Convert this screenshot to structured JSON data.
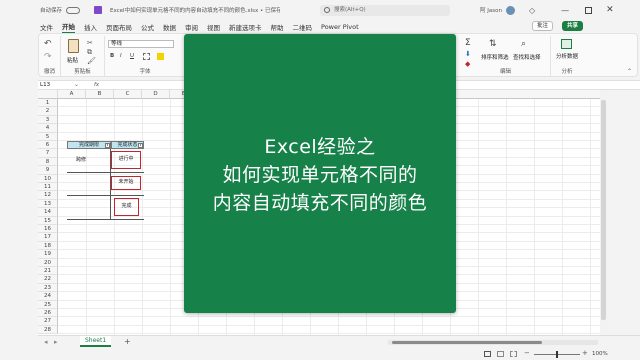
{
  "titlebar": {
    "autosave": "自动保存",
    "title": "Excel中如何实现单元格不同的内容自动填充不同的颜色.xlsx • 已保存",
    "search": "搜索(Alt+Q)",
    "user": "阿 Jason"
  },
  "tabs": [
    "文件",
    "开始",
    "插入",
    "页面布局",
    "公式",
    "数据",
    "审阅",
    "视图",
    "新建选项卡",
    "帮助",
    "二维码",
    "Power Pivot"
  ],
  "ribbon": {
    "comment_btn": "批注",
    "share_btn": "共享",
    "undo_label": "撤消",
    "clipboard_label": "剪贴板",
    "paste_label": "粘贴",
    "font_label": "字体",
    "font_name": "等线",
    "bold": "B",
    "italic": "I",
    "underline": "U",
    "sort_filter": "排序和筛选",
    "find_select": "查找和选择",
    "edit_label": "编辑",
    "analyze": "分析数据",
    "analyze_label": "分析"
  },
  "formula_bar": {
    "name_box": "L13",
    "fx": "fx"
  },
  "grid": {
    "columns": [
      "A",
      "B",
      "C",
      "D",
      "E"
    ],
    "rows": [
      "1",
      "2",
      "3",
      "4",
      "5",
      "6",
      "7",
      "8",
      "9",
      "10",
      "11",
      "12",
      "13",
      "14",
      "15",
      "16",
      "17",
      "18",
      "19",
      "20",
      "21",
      "22",
      "23",
      "24",
      "25",
      "26",
      "27",
      "28"
    ],
    "header_b": "完成期限",
    "header_c": "完成状态",
    "b_value": "跨修",
    "c_values": [
      "进行中",
      "未开始",
      "完成"
    ]
  },
  "sheet": {
    "tab": "Sheet1",
    "add": "+"
  },
  "status": {
    "zoom": "100%"
  },
  "overlay": {
    "line1": "Excel经验之",
    "line2": "如何实现单元格不同的",
    "line3": "内容自动填充不同的颜色"
  },
  "colors": {
    "excel_green": "#17814a",
    "header_fill": "#bfe6f0",
    "red_border": "#c0262d"
  }
}
